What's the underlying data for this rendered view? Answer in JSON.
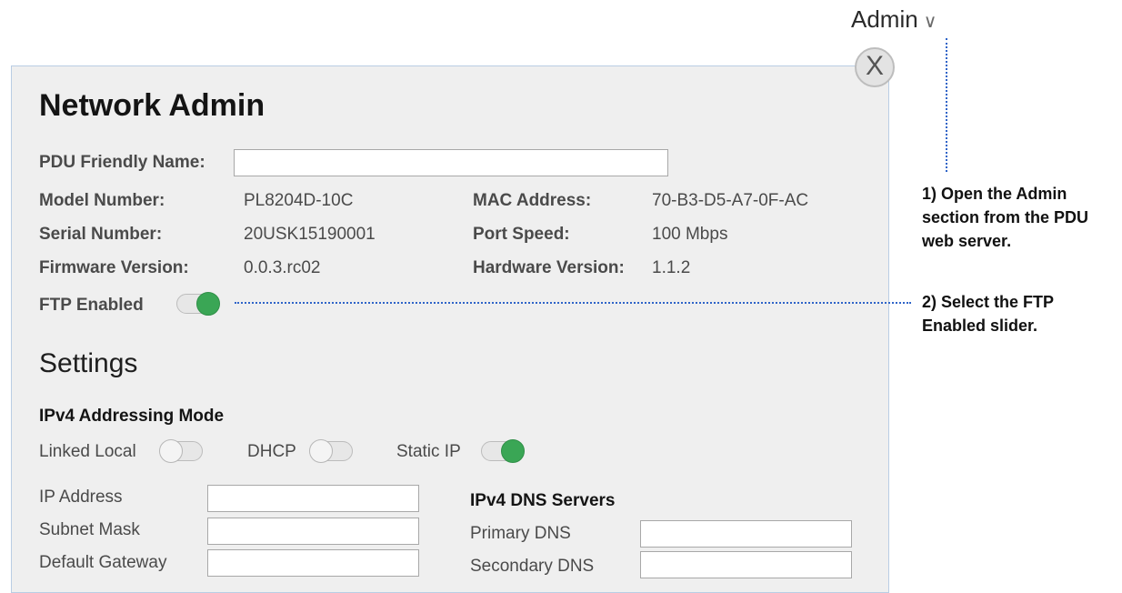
{
  "header": {
    "admin_menu_label": "Admin",
    "admin_chevron": "∨"
  },
  "panel": {
    "title": "Network Admin",
    "close_label": "X",
    "friendly_name": {
      "label": "PDU Friendly Name:",
      "value": ""
    },
    "info": {
      "model_label": "Model Number:",
      "model_value": "PL8204D-10C",
      "serial_label": "Serial Number:",
      "serial_value": "20USK15190001",
      "firmware_label": "Firmware Version:",
      "firmware_value": "0.0.3.rc02",
      "mac_label": "MAC Address:",
      "mac_value": "70-B3-D5-A7-0F-AC",
      "port_label": "Port Speed:",
      "port_value": "100 Mbps",
      "hardware_label": "Hardware Version:",
      "hardware_value": "1.1.2"
    },
    "ftp": {
      "label": "FTP Enabled",
      "enabled": true
    },
    "settings": {
      "title": "Settings",
      "ipv4_mode_heading": "IPv4 Addressing Mode",
      "modes": [
        {
          "label": "Linked Local",
          "enabled": false
        },
        {
          "label": "DHCP",
          "enabled": false
        },
        {
          "label": "Static IP",
          "enabled": true
        }
      ],
      "ip_fields": {
        "ip_label": "IP Address",
        "ip_value": "",
        "subnet_label": "Subnet Mask",
        "subnet_value": "",
        "gateway_label": "Default Gateway",
        "gateway_value": ""
      },
      "dns": {
        "heading": "IPv4 DNS Servers",
        "primary_label": "Primary DNS",
        "primary_value": "",
        "secondary_label": "Secondary DNS",
        "secondary_value": ""
      }
    }
  },
  "annotations": {
    "step1_lines": [
      "1) Open the Admin",
      "section from the PDU",
      "web server."
    ],
    "step2_lines": [
      "2) Select the FTP",
      "Enabled slider."
    ]
  },
  "colors": {
    "accent_blue": "#2f64c8",
    "toggle_on": "#3aa655",
    "panel_bg": "#efefef"
  }
}
